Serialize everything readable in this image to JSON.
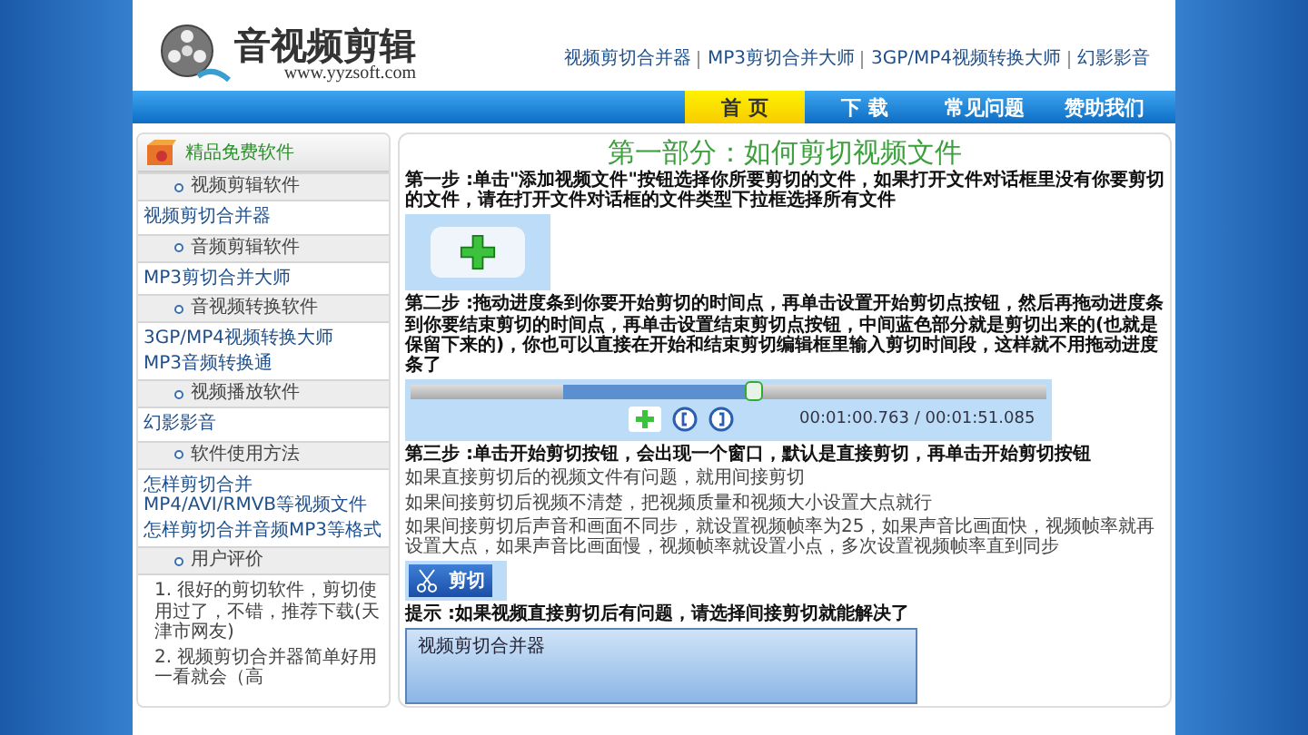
{
  "header": {
    "logo_title": "音视频剪辑",
    "logo_url": "www.yyzsoft.com",
    "links": [
      "视频剪切合并器",
      "MP3剪切合并大师",
      "3GP/MP4视频转换大师",
      "幻影影音"
    ]
  },
  "nav": [
    {
      "label": "首 页",
      "selected": true
    },
    {
      "label": "下 载",
      "selected": false
    },
    {
      "label": "常见问题",
      "selected": false
    },
    {
      "label": "赞助我们",
      "selected": false
    }
  ],
  "sidebar": {
    "title": "精品免费软件",
    "sections": [
      {
        "heading": "视频剪辑软件",
        "kind": "links",
        "items": [
          "视频剪切合并器"
        ]
      },
      {
        "heading": "音频剪辑软件",
        "kind": "links",
        "items": [
          "MP3剪切合并大师"
        ]
      },
      {
        "heading": "音视频转换软件",
        "kind": "links",
        "items": [
          "3GP/MP4视频转换大师",
          "MP3音频转换通"
        ]
      },
      {
        "heading": "视频播放软件",
        "kind": "links",
        "items": [
          "幻影影音"
        ]
      },
      {
        "heading": "软件使用方法",
        "kind": "links",
        "items": [
          "怎样剪切合并MP4/AVI/RMVB等视频文件",
          "怎样剪切合并音频MP3等格式"
        ]
      },
      {
        "heading": "用户评价",
        "kind": "comments",
        "items": [
          "1. 很好的剪切软件，剪切使用过了，不错，推荐下载(天津市网友)",
          "2. 视频剪切合并器简单好用一看就会（高"
        ]
      }
    ]
  },
  "main": {
    "title": "第一部分：如何剪切视频文件",
    "blocks": [
      {
        "kind": "step",
        "text": "第一步 :单击\"添加视频文件\"按钮选择你所要剪切的文件，如果打开文件对话框里没有你要剪切的文件，请在打开文件对话框的文件类型下拉框选择所有文件"
      },
      {
        "kind": "add-image"
      },
      {
        "kind": "step",
        "text": "第二步 :拖动进度条到你要开始剪切的时间点，再单击设置开始剪切点按钮，然后再拖动进度条到你要结束剪切的时间点，再单击设置结束剪切点按钮，中间蓝色部分就是剪切出来的(也就是保留下来的)，你也可以直接在开始和结束剪切编辑框里输入剪切时间段，这样就不用拖动进度条了"
      },
      {
        "kind": "progress-image",
        "level": 0.54,
        "time": "00:01:00.763 / 00:01:51.085"
      },
      {
        "kind": "step",
        "text": "第三步 :单击开始剪切按钮，会出现一个窗口，默认是直接剪切，再单击开始剪切按钮"
      },
      {
        "kind": "note",
        "text": "如果直接剪切后的视频文件有问题，就用间接剪切"
      },
      {
        "kind": "note",
        "text": "如果间接剪切后视频不清楚，把视频质量和视频大小设置大点就行"
      },
      {
        "kind": "note",
        "text": "如果间接剪切后声音和画面不同步，就设置视频帧率为25，如果声音比画面快，视频帧率就再设置大点，如果声音比画面慢，视频帧率就设置小点，多次设置视频帧率直到同步"
      },
      {
        "kind": "cut-image",
        "label": "剪切"
      },
      {
        "kind": "step",
        "text": "提示 :如果视频直接剪切后有问题，请选择间接剪切就能解决了"
      },
      {
        "kind": "dialog-image",
        "title": "视频剪切合并器"
      }
    ]
  }
}
